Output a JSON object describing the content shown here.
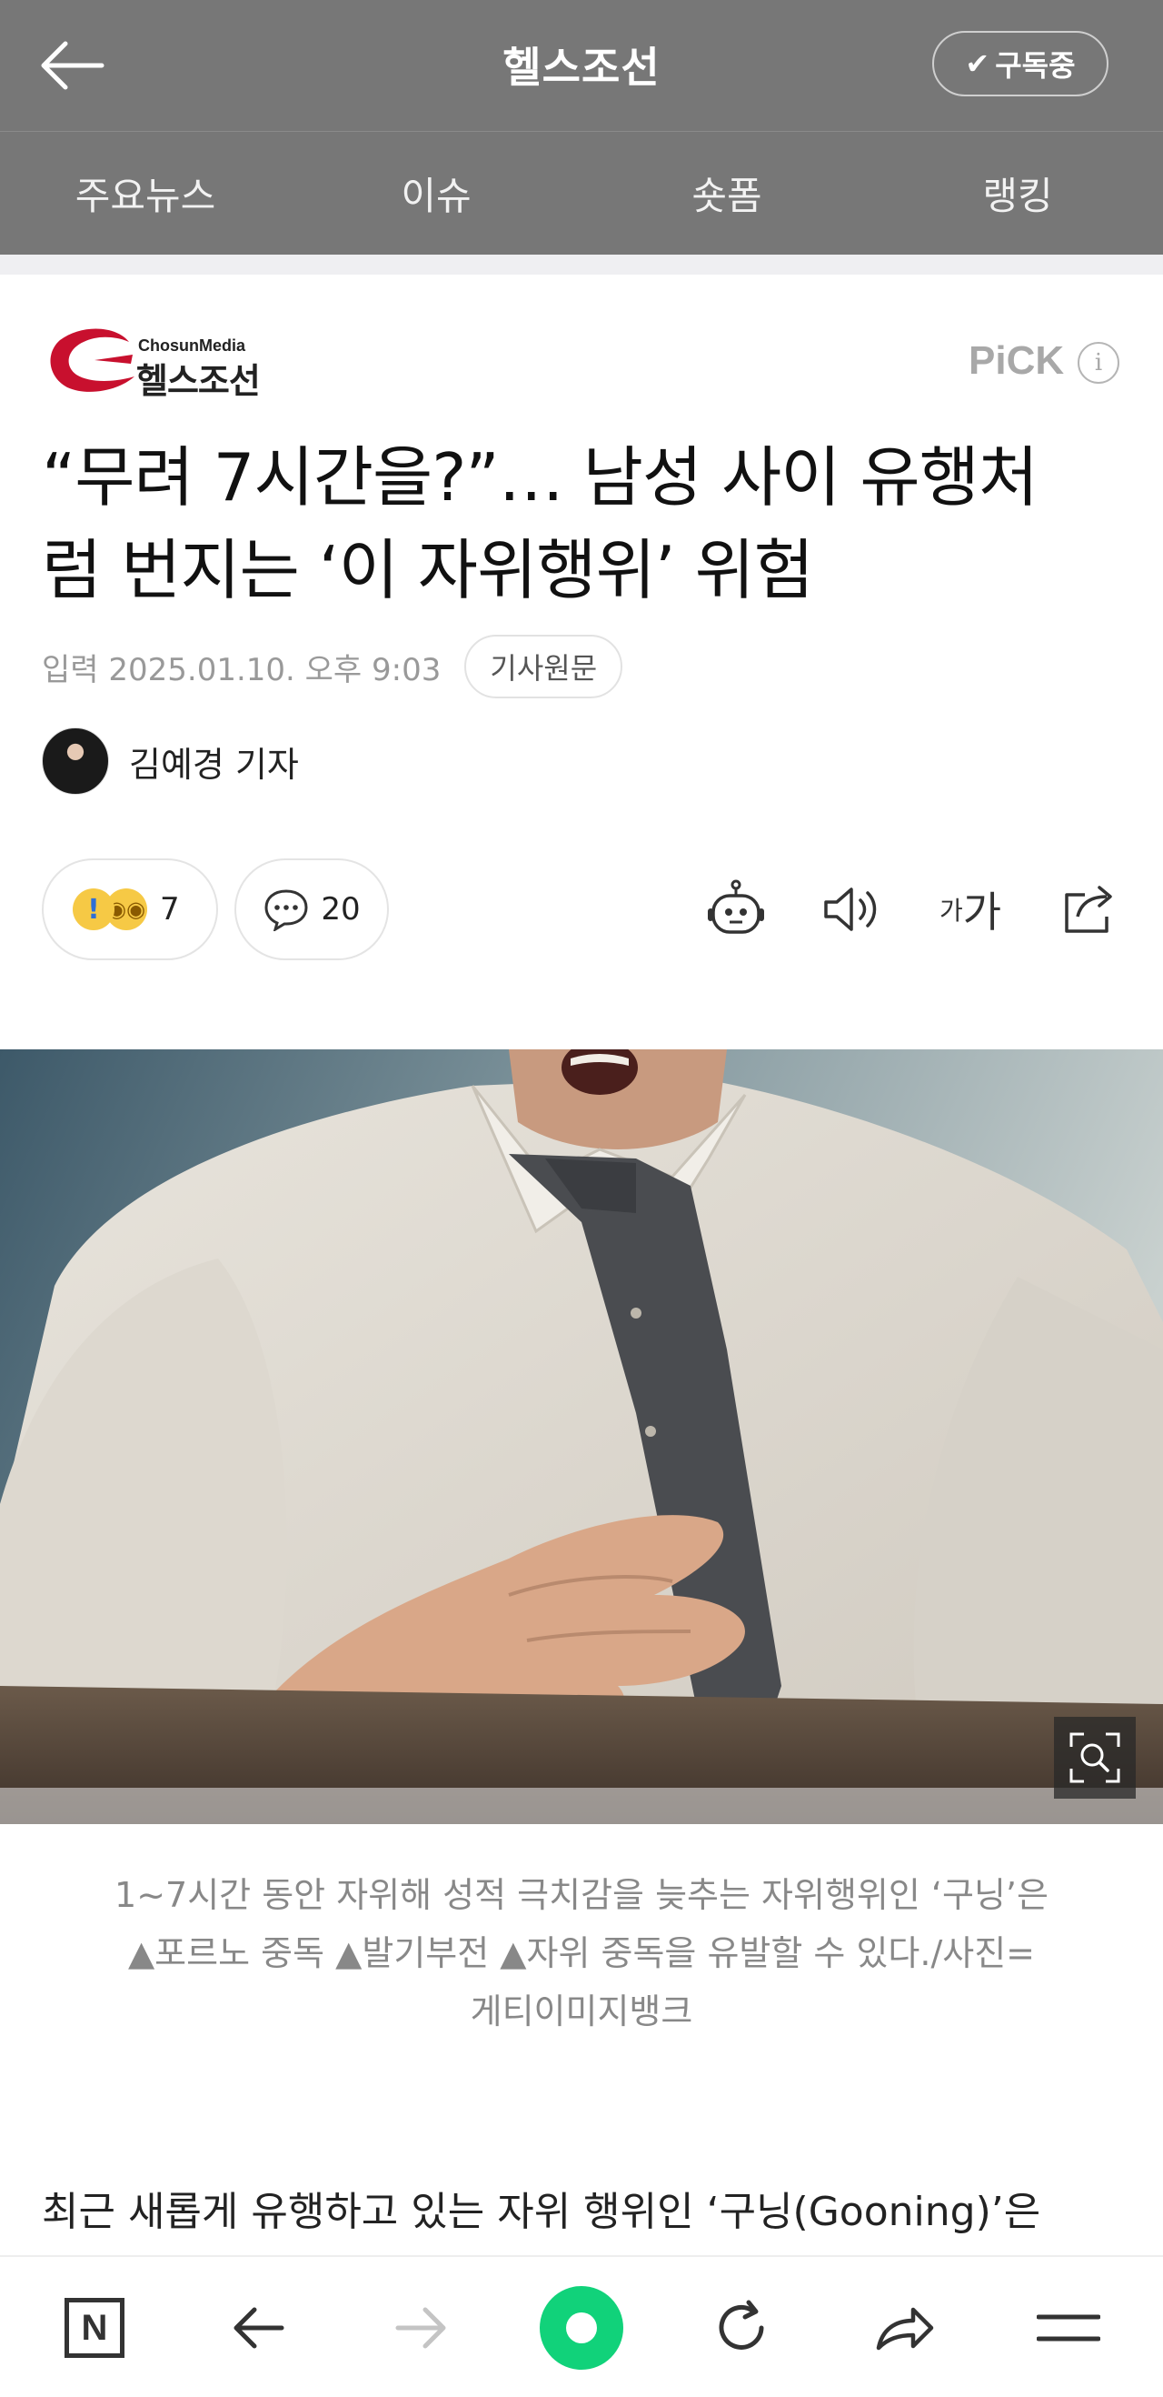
{
  "header": {
    "title": "헬스조선",
    "subscribe_label": "구독중",
    "icons": {
      "back": "arrow-left-icon",
      "subscribe": "check-icon"
    }
  },
  "nav": {
    "tabs": [
      {
        "label": "주요뉴스"
      },
      {
        "label": "이슈"
      },
      {
        "label": "숏폼"
      },
      {
        "label": "랭킹"
      }
    ]
  },
  "brand": {
    "sub": "ChosunMedia",
    "name": "헬스조선",
    "accent": "#c8102e"
  },
  "pick": {
    "label": "PiCK",
    "info": "i"
  },
  "article": {
    "headline_line1": "“무려 7시간을?”… 남성 사이 유행처",
    "headline_line2": "럼 번지는 ‘이 자위행위’ 위험",
    "date": "입력 2025.01.10. 오후 9:03",
    "original_label": "기사원문",
    "author": "김예경 기자",
    "reactions_count": "7",
    "comments_count": "20",
    "font_size_small": "가",
    "font_size_large": "가",
    "caption_line1": "1~7시간 동안 자위해 성적 극치감을 늦추는 자위행위인 ‘구닝’은",
    "caption_line2": "▲포르노 중독 ▲발기부전 ▲자위 중독을 유발할 수 있다./사진=",
    "caption_line3": "게티이미지뱅크",
    "body_first_line": "최근 새롭게 유행하고 있는 자위 행위인 ‘구닝(Gooning)’은"
  },
  "toolbar_icons": [
    "robot-icon",
    "speaker-icon",
    "font-size-icon",
    "share-icon"
  ],
  "bottom_bar": {
    "icons": [
      "naver-n-icon",
      "back-arrow-icon",
      "forward-arrow-icon",
      "home-icon",
      "refresh-icon",
      "share-arrow-icon",
      "menu-icon"
    ],
    "n_label": "N",
    "home_color": "#11d27a"
  }
}
